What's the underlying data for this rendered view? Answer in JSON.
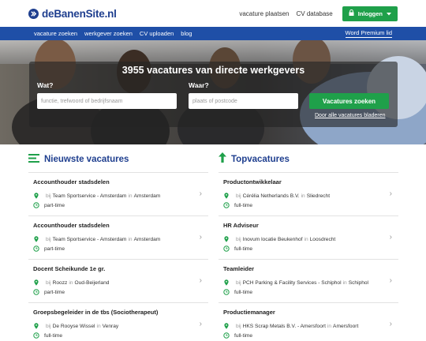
{
  "brand": {
    "name": "deBanenSite.nl",
    "accent": "#1f3f8f",
    "green": "#1fa04a",
    "nav_bg": "#1f4fa7"
  },
  "header": {
    "links": [
      "vacature plaatsen",
      "CV database"
    ],
    "login_label": "Inloggen"
  },
  "nav": {
    "items": [
      "vacature zoeken",
      "werkgever zoeken",
      "CV uploaden",
      "blog"
    ],
    "right_label": "Word Premium lid"
  },
  "hero": {
    "title": "3955 vacatures van directe werkgevers",
    "what_label": "Wat?",
    "what_placeholder": "functie, trefwoord of bedrijfsnaam",
    "where_label": "Waar?",
    "where_placeholder": "plaats of postcode",
    "search_label": "Vacatures zoeken",
    "browse_label": "Door alle vacatures bladeren"
  },
  "latest": {
    "title": "Nieuwste vacatures",
    "jobs": [
      {
        "title": "Accounthouder stadsdelen",
        "bij": "bij",
        "company": "Team Sportservice - Amsterdam",
        "in": "in",
        "city": "Amsterdam",
        "type": "part-time"
      },
      {
        "title": "Accounthouder stadsdelen",
        "bij": "bij",
        "company": "Team Sportservice - Amsterdam",
        "in": "in",
        "city": "Amsterdam",
        "type": "part-time"
      },
      {
        "title": "Docent Scheikunde 1e gr.",
        "bij": "bij",
        "company": "Roozz",
        "in": "in",
        "city": "Oud-Beijerland",
        "type": "part-time"
      },
      {
        "title": "Groepsbegeleider in de tbs (Sociotherapeut)",
        "bij": "bij",
        "company": "De Rooyse Wissel",
        "in": "in",
        "city": "Venray",
        "type": "full-time"
      }
    ]
  },
  "top": {
    "title": "Topvacatures",
    "jobs": [
      {
        "title": "Productontwikkelaar",
        "bij": "bij",
        "company": "Cérélia Netherlands B.V.",
        "in": "in",
        "city": "Sliedrecht",
        "type": "full-time"
      },
      {
        "title": "HR Adviseur",
        "bij": "bij",
        "company": "Inovum locatie Beukenhof",
        "in": "in",
        "city": "Loosdrecht",
        "type": "full-time"
      },
      {
        "title": "Teamleider",
        "bij": "bij",
        "company": "PCH Parking & Facility Services - Schiphol",
        "in": "in",
        "city": "Schiphol",
        "type": "full-time"
      },
      {
        "title": "Productiemanager",
        "bij": "bij",
        "company": "HKS Scrap Metals B.V. - Amersfoort",
        "in": "in",
        "city": "Amersfoort",
        "type": "full-time"
      }
    ]
  },
  "icons": {
    "logo": "chevron-circle-icon",
    "lock": "lock-icon",
    "caret": "caret-down-icon",
    "list": "list-icon",
    "arrow_up": "arrow-up-icon",
    "pin": "map-pin-icon",
    "clock": "clock-icon",
    "chevron": "chevron-right-icon"
  }
}
